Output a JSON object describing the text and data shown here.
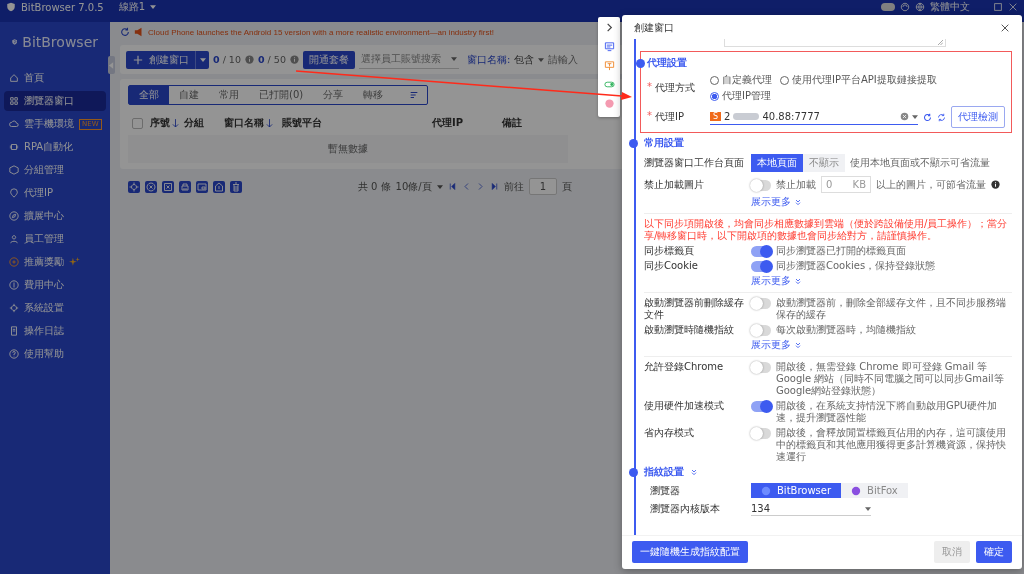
{
  "app": {
    "title": "BitBrowser 7.0.5",
    "line": "線路1",
    "language": "繁體中文"
  },
  "sidebar": {
    "logo": "BitBrowser",
    "items": [
      {
        "label": "首頁",
        "selected": false,
        "highlighted": false
      },
      {
        "label": "瀏覽器窗口",
        "selected": true,
        "highlighted": false
      },
      {
        "label": "雲手機環境",
        "selected": false,
        "highlighted": false,
        "badge": "NEW"
      },
      {
        "label": "RPA自動化",
        "selected": false,
        "highlighted": false
      },
      {
        "label": "分組管理",
        "selected": false,
        "highlighted": false
      },
      {
        "label": "代理IP",
        "selected": false,
        "highlighted": false
      },
      {
        "label": "擴展中心",
        "selected": false,
        "highlighted": false
      },
      {
        "label": "員工管理",
        "selected": false,
        "highlighted": false
      },
      {
        "label": "推薦獎勵",
        "selected": false,
        "highlighted": true
      },
      {
        "label": "費用中心",
        "selected": false,
        "highlighted": false
      },
      {
        "label": "系統設置",
        "selected": false,
        "highlighted": false
      },
      {
        "label": "操作日誌",
        "selected": false,
        "highlighted": false
      },
      {
        "label": "使用幫助",
        "selected": false,
        "highlighted": false
      }
    ]
  },
  "notice": {
    "text": "Cloud Phone launches the Android 15 version with a more realistic environment—an industry first!"
  },
  "toolbar": {
    "create_button": "創建窗口",
    "window_count": "0",
    "window_limit": "/ 10",
    "member_count": "0",
    "member_limit": "/ 50",
    "plan_button": "開通套餐",
    "employee_select": {
      "placeholder": "選擇員工賬號搜索"
    },
    "name_filter": {
      "label": "窗口名稱:",
      "operator": "包含",
      "placeholder": "請輸入"
    }
  },
  "tabs": [
    {
      "label": "全部",
      "selected": true
    },
    {
      "label": "自建",
      "selected": false
    },
    {
      "label": "常用",
      "selected": false
    },
    {
      "label": "已打開(0)",
      "selected": false
    },
    {
      "label": "分享",
      "selected": false
    },
    {
      "label": "轉移",
      "selected": false
    }
  ],
  "table": {
    "all_selected": false,
    "columns": [
      {
        "label": "序號",
        "sortable": true
      },
      {
        "label": "分組",
        "sortable": false
      },
      {
        "label": "窗口名稱",
        "sortable": true
      },
      {
        "label": "賬號平台",
        "sortable": false
      },
      {
        "label": "代理IP",
        "sortable": false
      },
      {
        "label": "備註",
        "sortable": false
      }
    ],
    "empty_text": "暫無數據"
  },
  "pagination": {
    "total": "共 0 條",
    "page_size": "10條/頁",
    "goto_label": "前往",
    "page": "1",
    "page_suffix": "頁"
  },
  "dialog": {
    "title": "創建窗口",
    "proxy_section": {
      "title": "代理設置",
      "method": {
        "required_mark": "*",
        "label": "代理方式",
        "options": [
          {
            "label": "自定義代理",
            "selected": false
          },
          {
            "label": "使用代理IP平台API提取鏈接提取",
            "selected": false
          },
          {
            "label": "代理IP管理",
            "selected": true
          }
        ]
      },
      "proxy_ip": {
        "required_mark": "*",
        "label": "代理IP",
        "provider_badge": "S",
        "value_parts": [
          "2",
          "40.88:7777"
        ],
        "check_button": "代理檢測"
      }
    },
    "common_section": {
      "title": "常用設置",
      "workbench": {
        "label": "瀏覽器窗口工作台頁面",
        "options": [
          {
            "label": "本地頁面",
            "selected": true
          },
          {
            "label": "不顯示",
            "selected": false
          }
        ],
        "hint": "使用本地頁面或不顯示可省流量"
      },
      "block_images": {
        "label": "禁止加載圖片",
        "on": false,
        "toggle_text": "禁止加載",
        "size": "0",
        "unit": "KB",
        "hint": "以上的圖片，可節省流量"
      },
      "show_more": "展示更多",
      "warning": "以下同步項開啟後，均會同步相應數據到雲端（便於跨設備使用/員工操作）；當分享/轉移窗口時，以下開啟項的數據也會同步給對方，請謹慎操作。",
      "sync_settings": [
        {
          "label": "同步標籤頁",
          "on": true,
          "description": "同步瀏覽器已打開的標籤頁面"
        },
        {
          "label": "同步Cookie",
          "on": true,
          "description": "同步瀏覽器Cookies，保持登錄狀態"
        }
      ],
      "sync_show_more": "展示更多",
      "startup_settings": [
        {
          "label": "啟動瀏覽器前刪除緩存文件",
          "on": false,
          "description": "啟動瀏覽器前，刪除全部緩存文件，且不同步服務端保存的緩存"
        },
        {
          "label": "啟動瀏覽時隨機指紋",
          "on": false,
          "description": "每次啟動瀏覽器時，均隨機指紋"
        }
      ],
      "startup_show_more": "展示更多",
      "other_settings": [
        {
          "label": "允許登錄Chrome",
          "on": false,
          "description": "開啟後，無需登錄 Chrome 即可登錄 Gmail 等 Google 網站（同時不同電腦之間可以同步Gmail等Google網站登錄狀態）"
        },
        {
          "label": "使用硬件加速模式",
          "on": true,
          "description": "開啟後，在系統支持情況下將自動啟用GPU硬件加速，提升瀏覽器性能"
        },
        {
          "label": "省內存模式",
          "on": false,
          "description": "開啟後，會釋放閒置標籤頁佔用的內存，這可讓使用中的標籤頁和其他應用獲得更多計算機資源，保持快速運行"
        }
      ]
    },
    "fingerprint_section": {
      "title": "指紋設置",
      "browser": {
        "label": "瀏覽器",
        "options": [
          {
            "label": "BitBrowser",
            "selected": true
          },
          {
            "label": "BitFox",
            "selected": false
          }
        ]
      },
      "kernel": {
        "label": "瀏覽器內核版本",
        "value": "134"
      }
    },
    "footer": {
      "random_button": "一鍵隨機生成指紋配置",
      "cancel_button": "取消",
      "ok_button": "確定"
    }
  }
}
